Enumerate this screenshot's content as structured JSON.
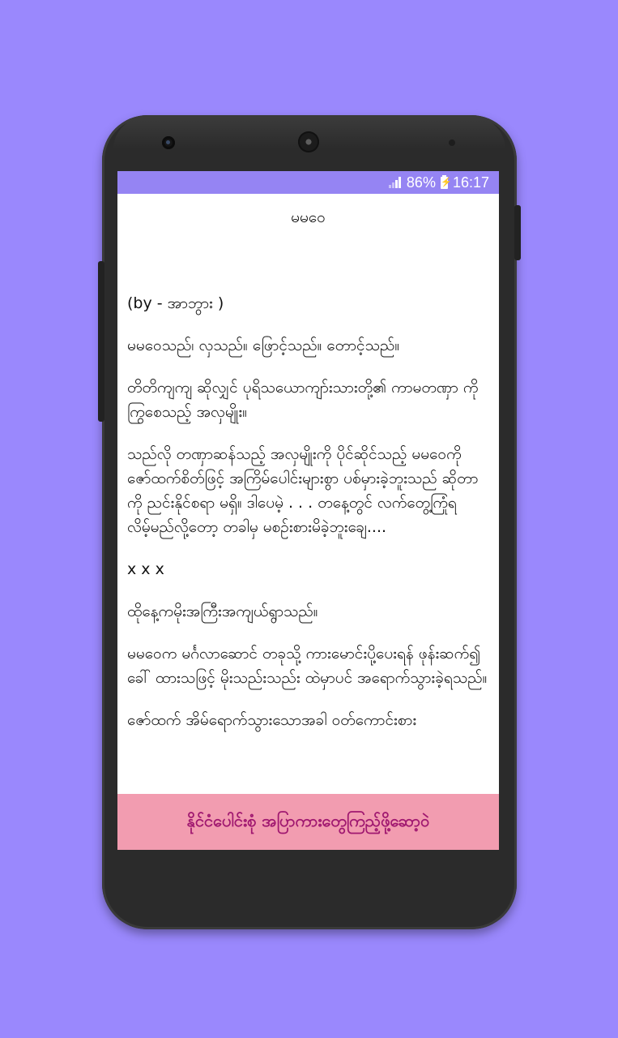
{
  "status_bar": {
    "battery_percent": "86%",
    "time": "16:17",
    "signal_icon": "signal-icon",
    "battery_icon": "battery-charging-icon"
  },
  "article": {
    "title": "မမဝေ",
    "paragraphs": [
      "(by - အာဘွား )",
      "မမဝေသည်၊ လှသည်။ ဖြောင့်သည်။ တောင့်သည်။",
      "တိတိကျကျ ဆိုလျှင် ပုရိသယောကျာ်းသားတို့၏ ကာမတဏှာ ကိုကြွစေသည့် အလှမျိုး။",
      "သည်လို တဏှာဆန်သည့် အလှမျိုးကို ပိုင်ဆိုင်သည့် မမဝေကို ဇော်ထက်စိတ်ဖြင့် အကြိမ်ပေါင်းများစွာ ပစ်မှားခဲ့ဘူးသည် ဆိုတာကို ညင်းနိုင်စရာ မရှိ။ ဒါပေမဲ့ . . . တနေ့တွင် လက်တွေ့ကြုံရလိမ့်မည်လို့တော့ တခါမှ မစဉ်းစားမိခဲ့ဘူးချေ....",
      "x x x",
      "ထိုနေ့ကမိုးအကြီးအကျယ်ရွာသည်။",
      "မမဝေက မင်္ဂလာဆောင် တခုသို့ ကားမောင်းပို့ပေးရန် ဖုန်းဆက်၍ ခေါ် ထားသဖြင့် မိုးသည်းသည်း ထဲမှာပင် အရောက်သွားခဲ့ရသည်။",
      "ဇော်ထက် အိမ်ရောက်သွားသောအခါ ဝတ်ကောင်းစား"
    ]
  },
  "banner": {
    "label": "နိုင်ငံပေါင်းစုံ အပြာကားတွေကြည့်ဖို့ဆော့ဝဲ",
    "background_color": "#f29cb0",
    "text_color": "#a01870"
  },
  "colors": {
    "background": "#9a88fd",
    "status_bar": "#9584f3"
  }
}
